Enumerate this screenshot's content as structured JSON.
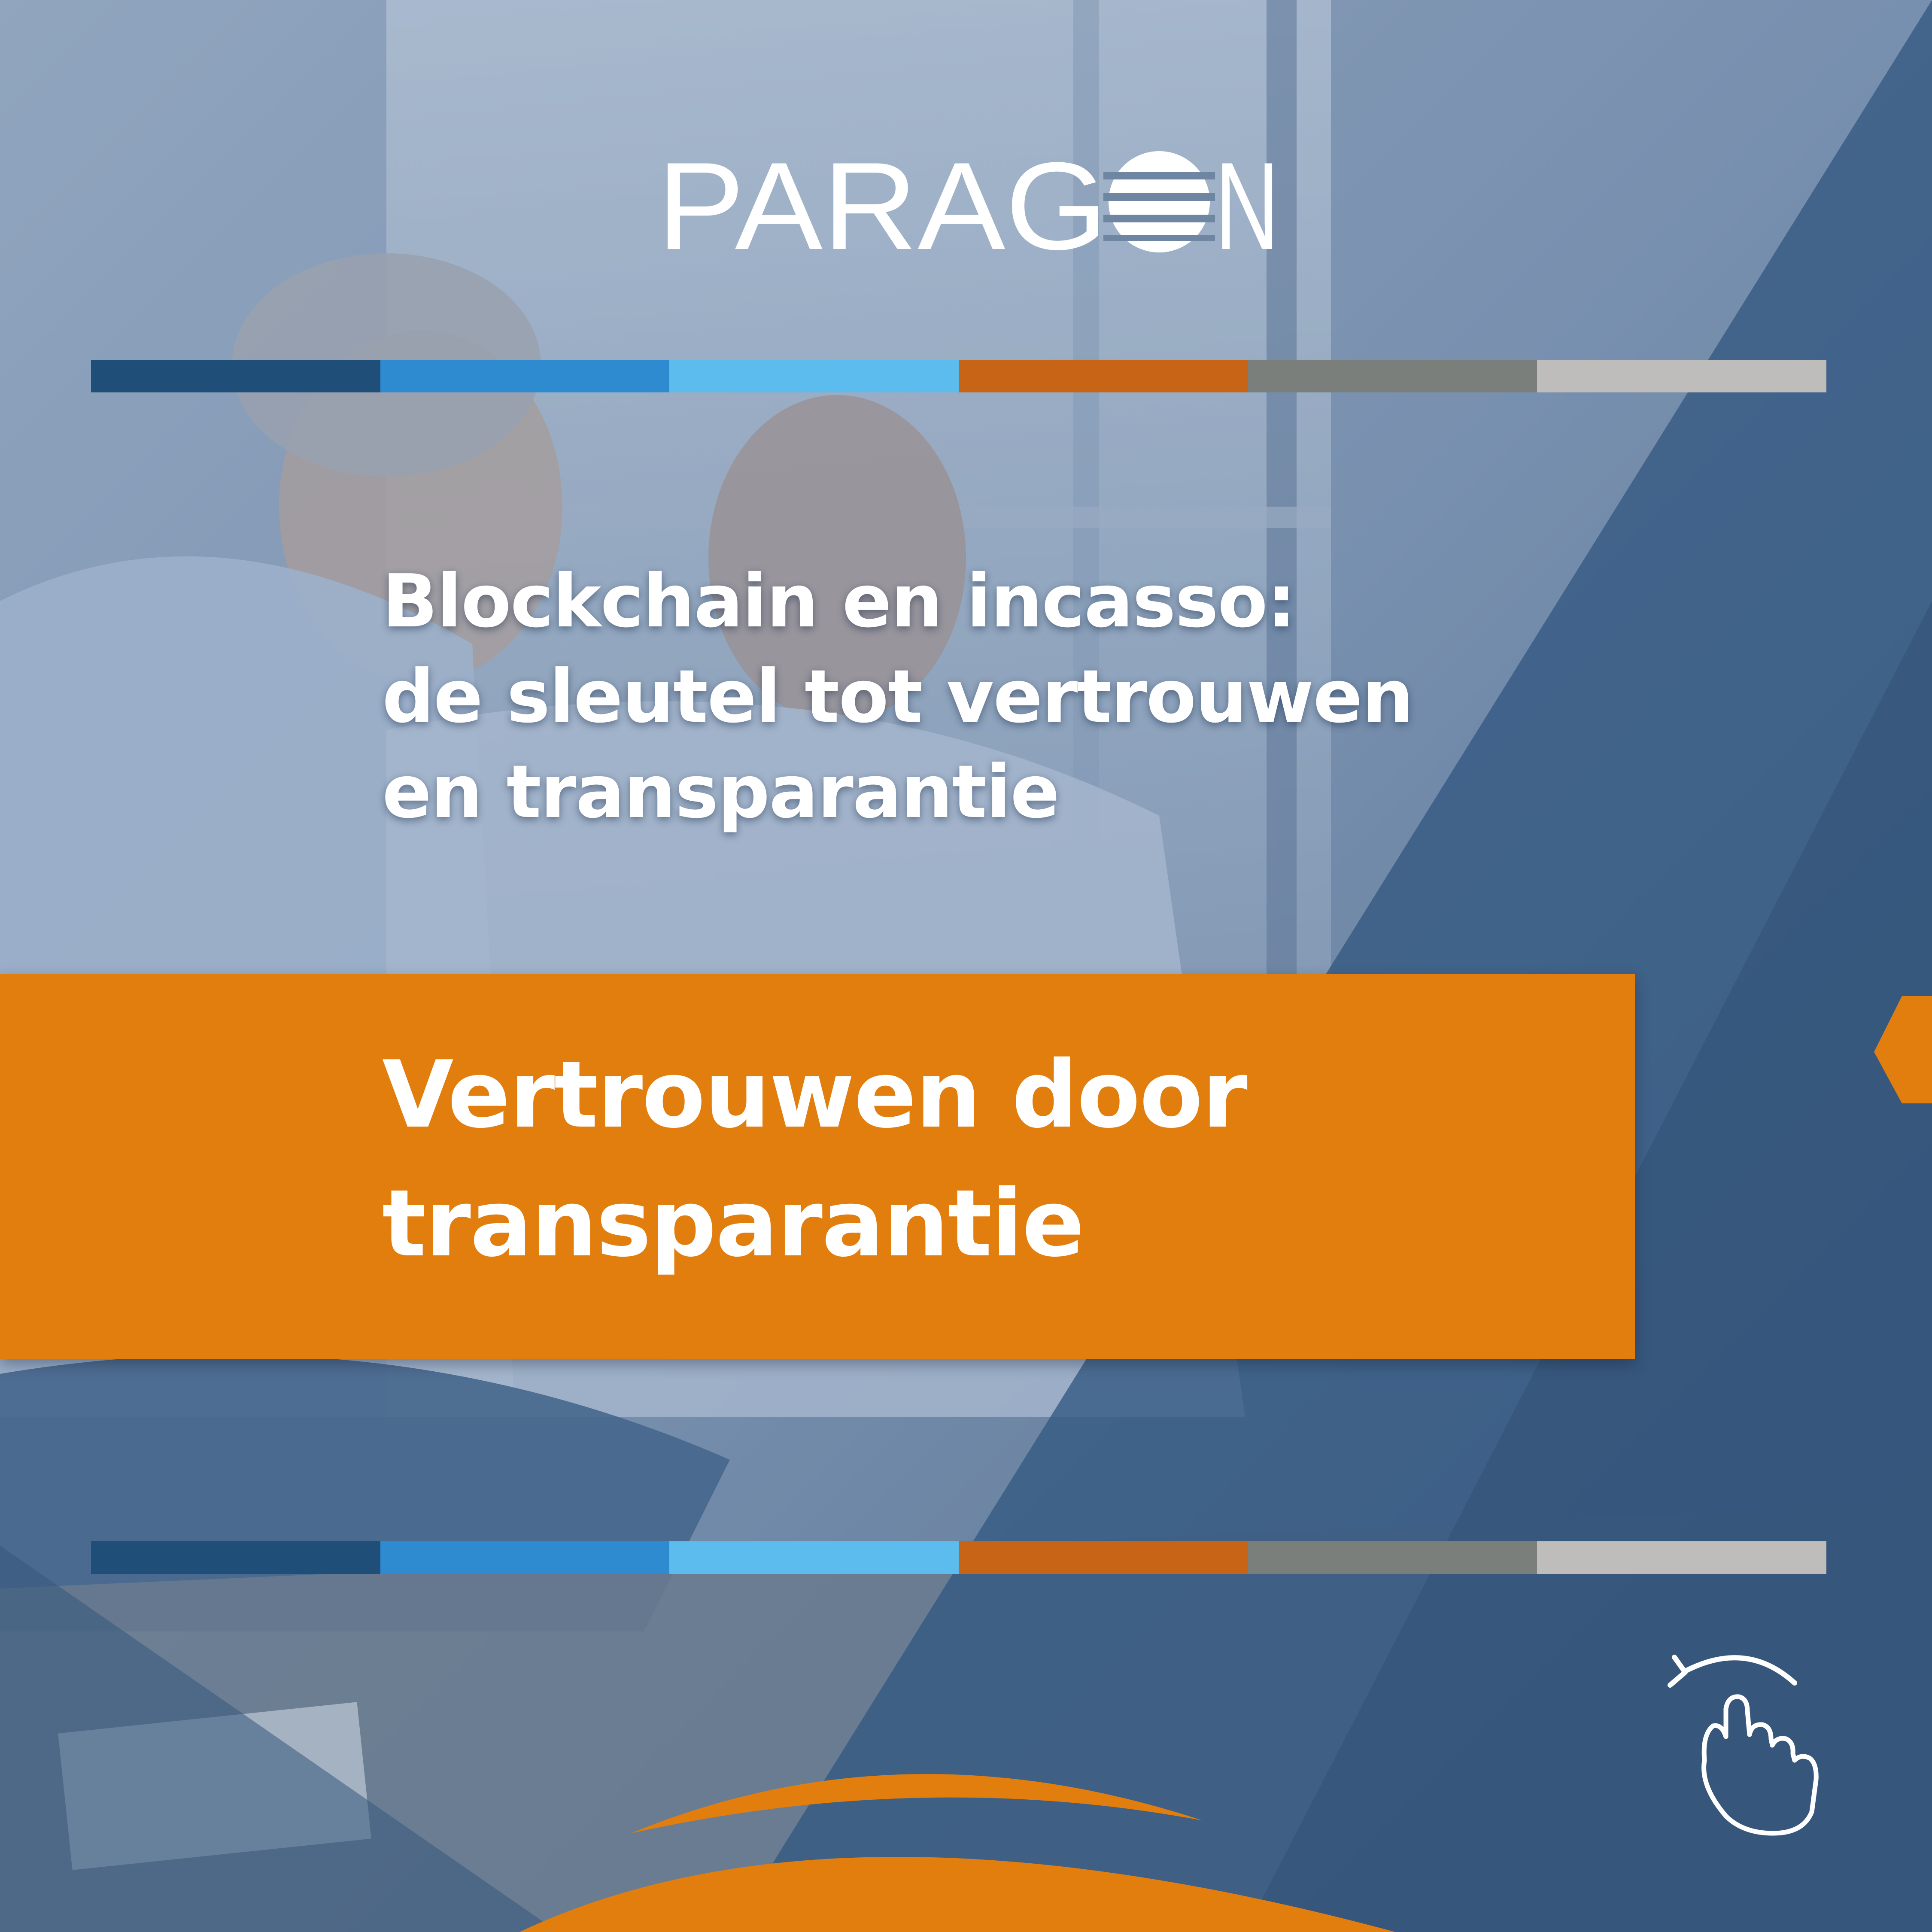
{
  "logo": {
    "text": "PARAGON",
    "icon": "globe-icon"
  },
  "headline": {
    "lines": [
      "Blockchain en incasso:",
      "de sleutel tot vertrouwen",
      "en transparantie"
    ]
  },
  "subtitle": {
    "lines": [
      "Vertrouwen door",
      "transparantie"
    ]
  },
  "color_bar": {
    "colors": [
      "#1f4e79",
      "#2e8bd0",
      "#5bbced",
      "#c86416",
      "#7a7f7c",
      "#bfbdbb"
    ]
  },
  "colors": {
    "accent_orange": "#e17e0e",
    "overlay_blue": "#284e78",
    "text": "#ffffff"
  },
  "swipe_hint": {
    "icon": "swipe-hand-icon"
  }
}
